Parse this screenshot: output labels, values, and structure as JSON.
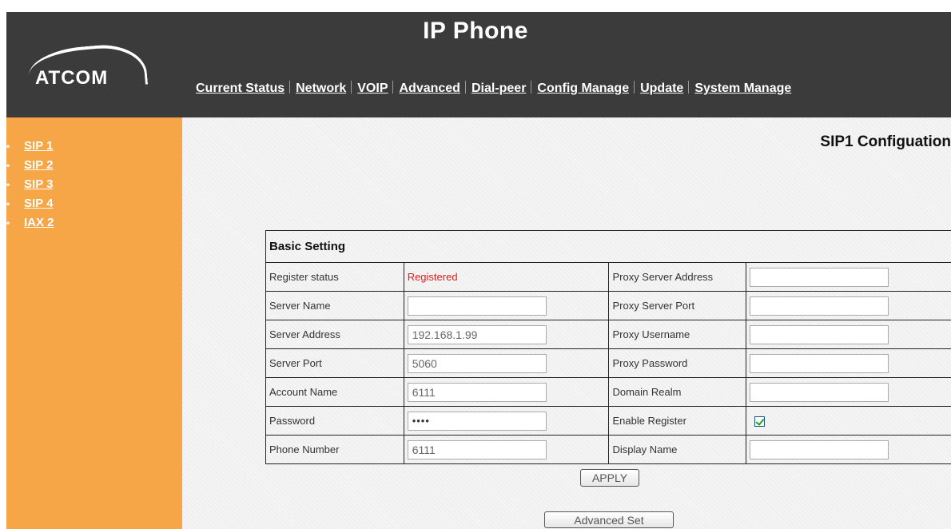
{
  "header": {
    "title": "IP Phone",
    "logo_text": "ATCOM",
    "nav": [
      {
        "label": "Current Status"
      },
      {
        "label": "Network"
      },
      {
        "label": "VOIP"
      },
      {
        "label": "Advanced"
      },
      {
        "label": "Dial-peer"
      },
      {
        "label": "Config Manage"
      },
      {
        "label": "Update"
      },
      {
        "label": "System Manage"
      }
    ]
  },
  "sidebar": {
    "bullet": "•",
    "items": [
      {
        "label": "SIP 1"
      },
      {
        "label": "SIP 2"
      },
      {
        "label": "SIP 3"
      },
      {
        "label": "SIP 4"
      },
      {
        "label": "IAX 2"
      }
    ]
  },
  "main": {
    "heading": "SIP1 Configuation",
    "section_title": "Basic Setting",
    "left_rows": [
      {
        "label": "Register status",
        "value": "Registered"
      },
      {
        "label": "Server Name",
        "value": ""
      },
      {
        "label": "Server Address",
        "value": "192.168.1.99"
      },
      {
        "label": "Server Port",
        "value": "5060"
      },
      {
        "label": "Account Name",
        "value": "6111"
      },
      {
        "label": "Password",
        "value": "••••"
      },
      {
        "label": "Phone Number",
        "value": "6111"
      }
    ],
    "right_rows": [
      {
        "label": "Proxy Server Address",
        "value": ""
      },
      {
        "label": "Proxy Server Port",
        "value": ""
      },
      {
        "label": "Proxy Username",
        "value": ""
      },
      {
        "label": "Proxy Password",
        "value": ""
      },
      {
        "label": "Domain Realm",
        "value": ""
      },
      {
        "label": "Enable Register",
        "checked": true
      },
      {
        "label": "Display Name",
        "value": ""
      }
    ],
    "apply_label": "APPLY",
    "advanced_label": "Advanced Set"
  },
  "colors": {
    "header_bg": "#3b3b3b",
    "sidebar_bg": "#f7a647",
    "registered_text": "#e4191c"
  }
}
